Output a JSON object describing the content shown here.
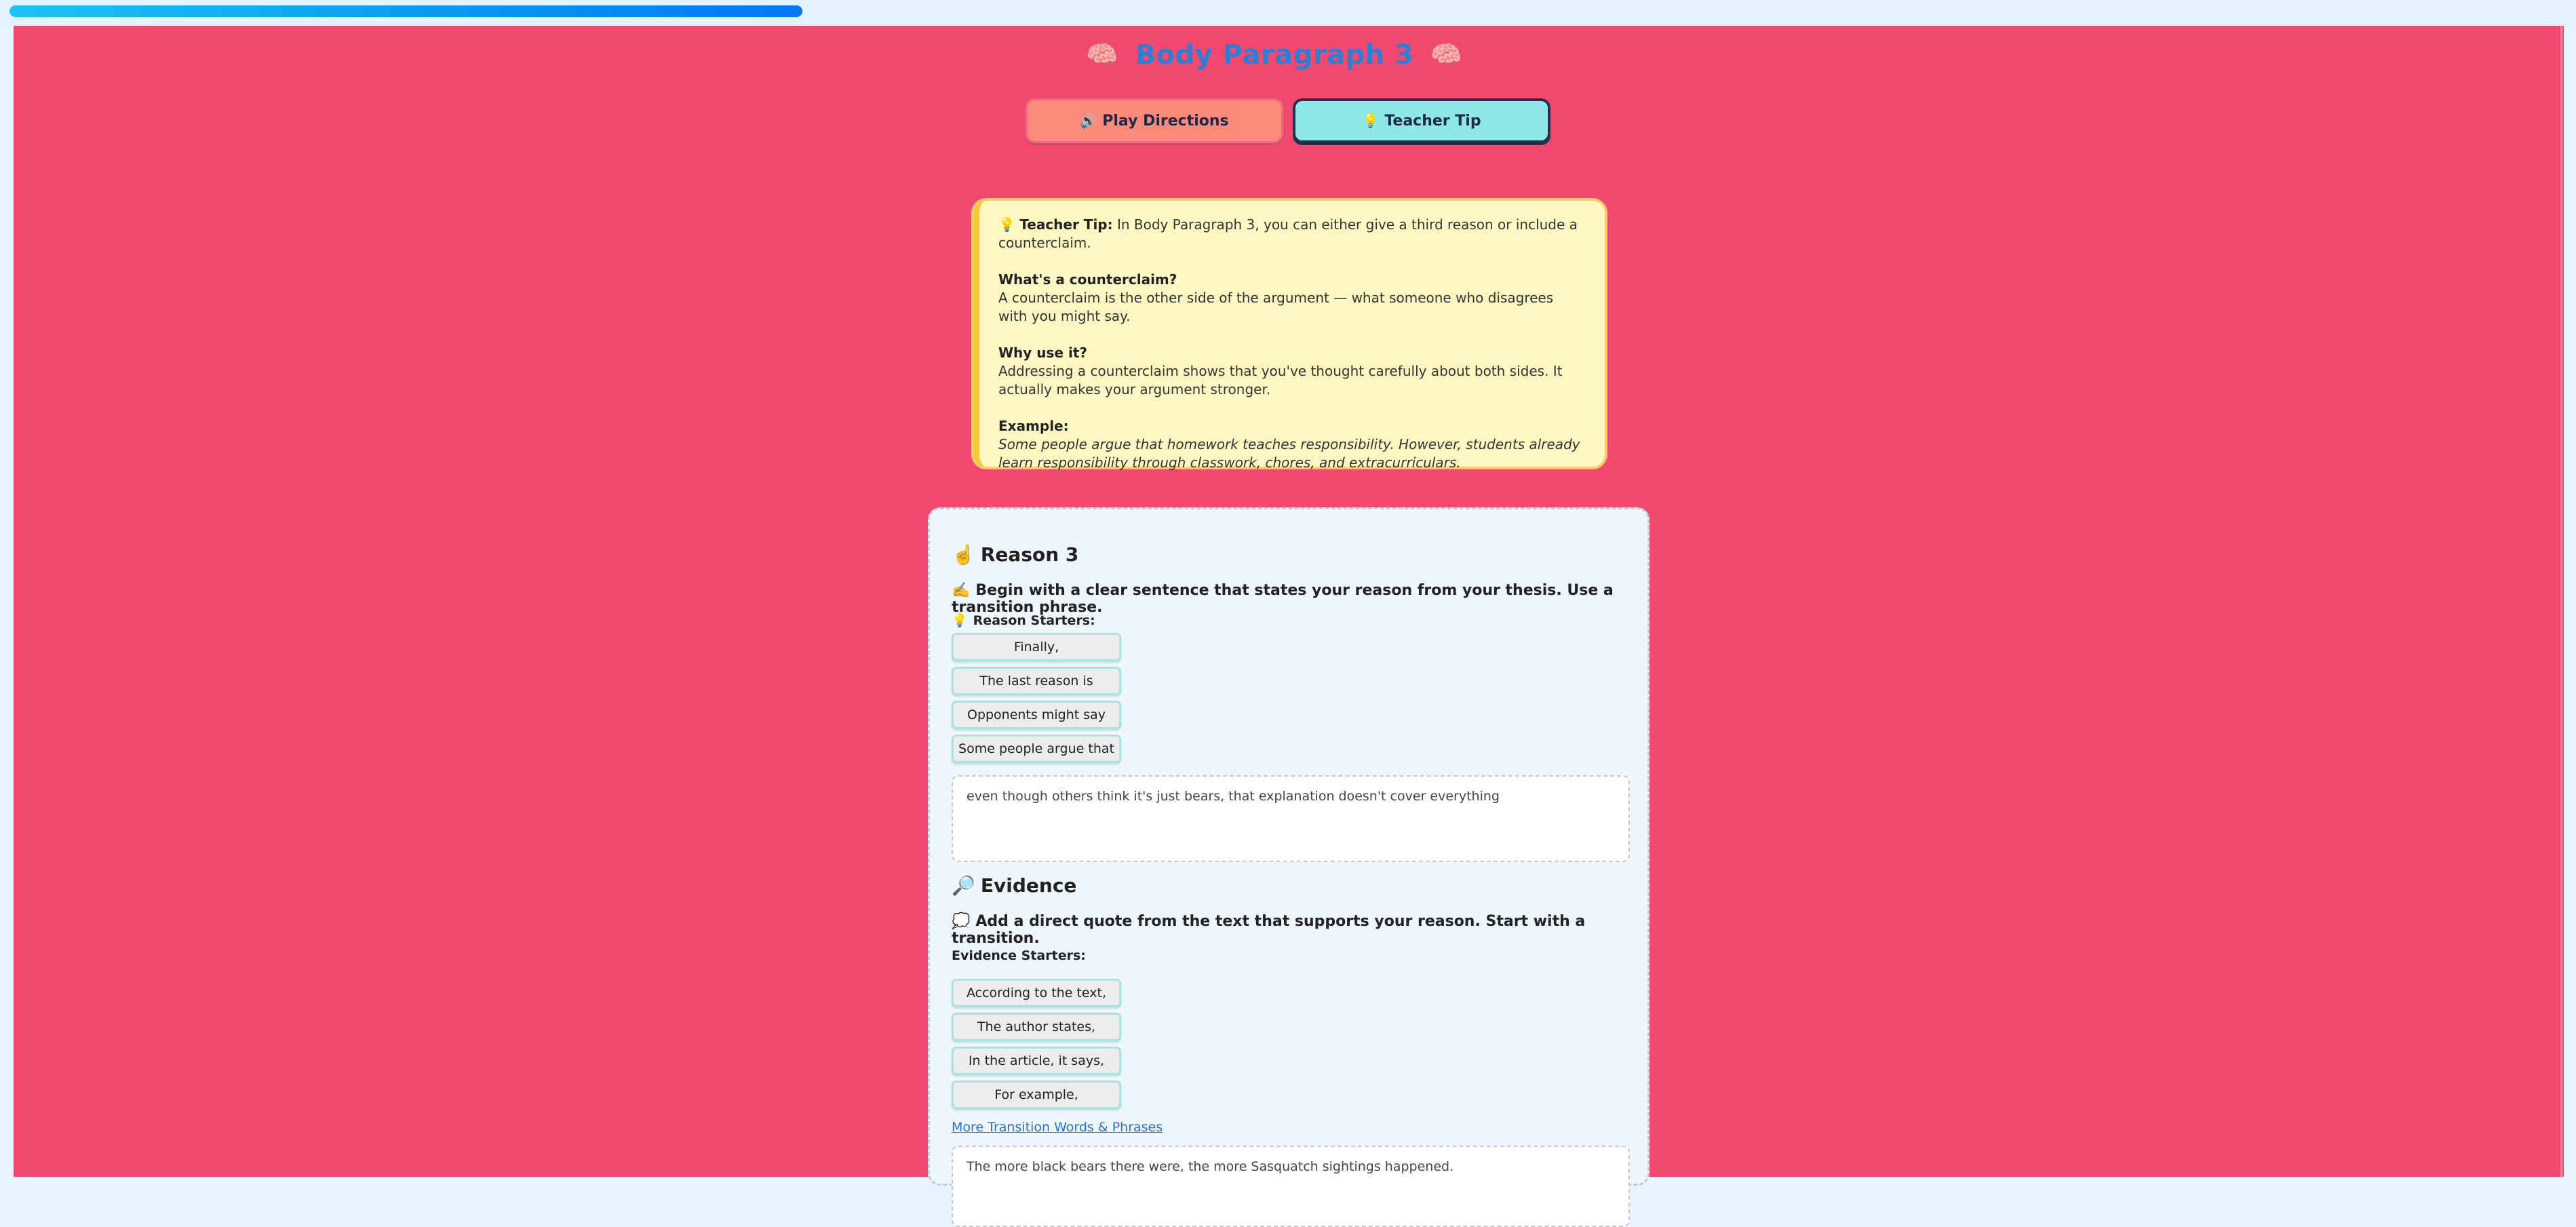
{
  "progress": {
    "fraction": 0.31
  },
  "header": {
    "title": "Body Paragraph 3",
    "title_emoji": "🧠"
  },
  "tabs": [
    {
      "label": "Play Directions",
      "icon": "🔊",
      "icon_name": "speaker-icon"
    },
    {
      "label": "Teacher Tip",
      "icon": "💡",
      "icon_name": "lightbulb-icon"
    }
  ],
  "teacher_tip": {
    "icon": "💡",
    "lead_label": "Teacher Tip:",
    "lead_text": " In Body Paragraph 3, you can either give a third reason or include a counterclaim.",
    "q1_heading": "What's a counterclaim?",
    "q1_text": "A counterclaim is the other side of the argument — what someone who disagrees with you might say.",
    "q2_heading": "Why use it?",
    "q2_text": "Addressing a counterclaim shows that you've thought carefully about both sides. It actually makes your argument stronger.",
    "example_heading": "Example:",
    "example_text": "Some people argue that homework teaches responsibility. However, students already learn responsibility through classwork, chores, and extracurriculars."
  },
  "reason": {
    "icon": "☝️",
    "heading": "Reason 3",
    "instruction_icon": "✍️",
    "instruction": "Begin with a clear sentence that states your reason from your thesis. Use a transition phrase.",
    "starters_icon": "💡",
    "starters_label": "Reason Starters:",
    "starters": [
      "Finally,",
      "The last reason is",
      "Opponents might say",
      "Some people argue that"
    ],
    "answer": "even though others think it's just bears, that explanation doesn't cover everything"
  },
  "evidence": {
    "icon": "🔎",
    "heading": "Evidence",
    "instruction_icon": "💭",
    "instruction": "Add a direct quote from the text that supports your reason. Start with a transition.",
    "starters_label": "Evidence Starters:",
    "starters": [
      "According to the text,",
      "The author states,",
      "In the article, it says,",
      "For example,"
    ],
    "link": "More Transition Words & Phrases",
    "answer": "The more black bears there were, the more Sasquatch sightings happened."
  }
}
